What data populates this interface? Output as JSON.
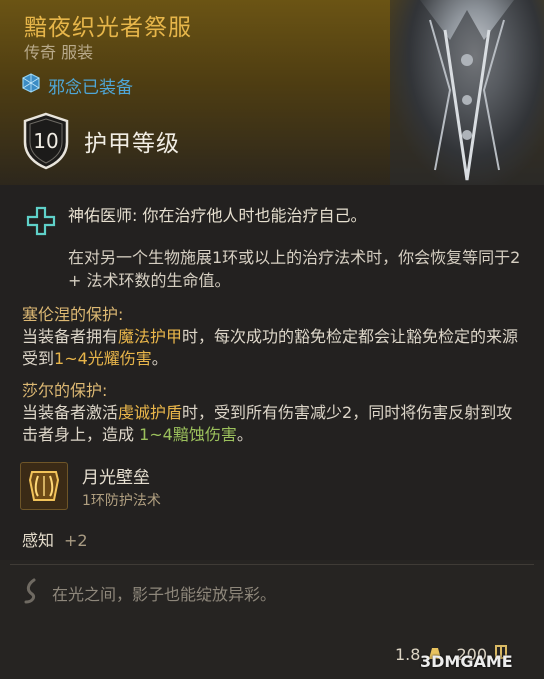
{
  "item": {
    "name": "黯夜织光者祭服",
    "rarity_type": "传奇 服装",
    "equip_status": "邪念已装备"
  },
  "armor_class": {
    "value": "10",
    "label": "护甲等级"
  },
  "passive": {
    "name": "神佑医师: 你在治疗他人时也能治疗自己。",
    "desc": "在对另一个生物施展1环或以上的治疗法术时，你会恢复等同于2 + 法术环数的生命值。"
  },
  "blocks": [
    {
      "title": "塞伦涅的保护:",
      "parts": [
        "当装备者拥有",
        "魔法护甲",
        "时，每次成功的豁免检定都会让豁免检定的来源受到",
        "1~4光耀伤害",
        "。"
      ]
    },
    {
      "title": "莎尔的保护:",
      "parts": [
        "当装备者激活",
        "虔诚护盾",
        "时，受到所有伤害减少2，同时将伤害反射到攻击者身上，造成 ",
        "1~4黯蚀伤害",
        "。"
      ]
    }
  ],
  "spell": {
    "name": "月光壁垒",
    "level": "1环防护法术"
  },
  "stat": {
    "label": "感知",
    "value": "+2"
  },
  "flavor": "在光之间，影子也能绽放异彩。",
  "footer": {
    "weight": "1.8",
    "price": "200",
    "watermark": "3DMGAME"
  },
  "colors": {
    "title_gold": "#e7b64a",
    "equip_blue": "#4fa6d6",
    "radiant_gold": "#e8b54a",
    "necrotic_green": "#9bc05c"
  }
}
